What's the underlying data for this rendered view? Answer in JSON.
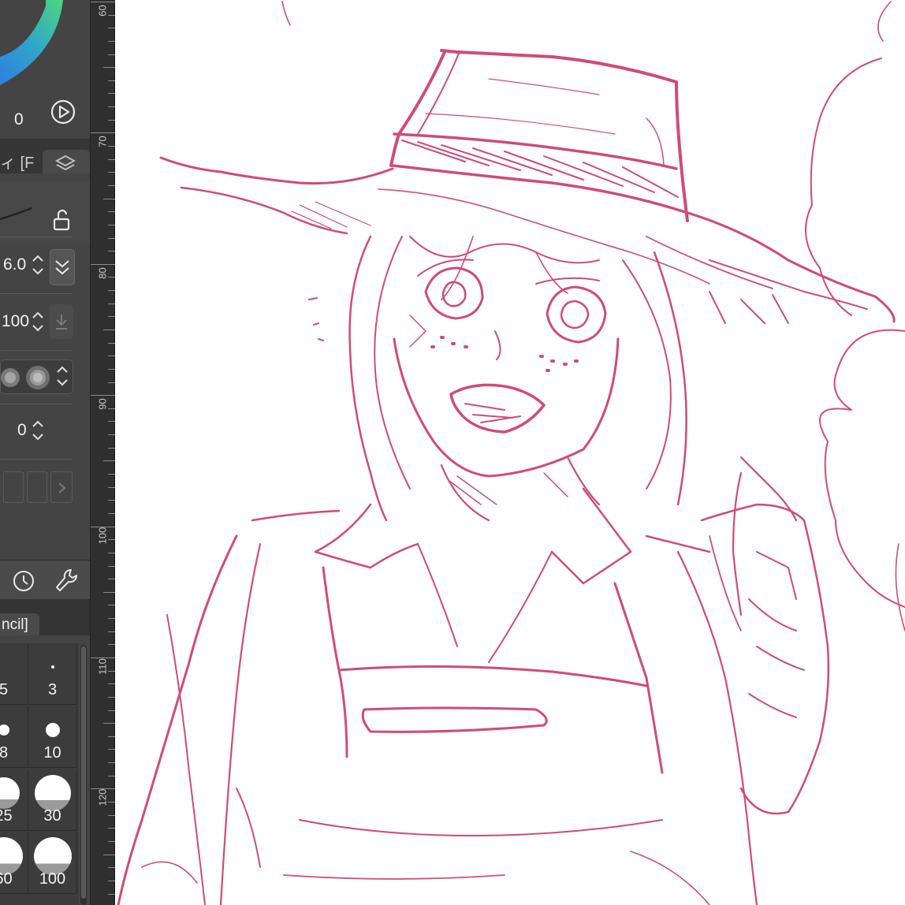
{
  "panel": {
    "color_value": "0",
    "tab_label": "ィ [F",
    "brush_size_value": "6.0",
    "opacity_value": "100",
    "stabilizer_value": "0",
    "subtool_tab_label": "ncil]",
    "brush_sizes": [
      {
        "label": "5",
        "dot": 0
      },
      {
        "label": "3",
        "dot": 4
      },
      {
        "label": "8",
        "dot": 14
      },
      {
        "label": "10",
        "dot": 18
      },
      {
        "label": "25",
        "dot": 40
      },
      {
        "label": "30",
        "dot": 46
      },
      {
        "label": "60",
        "dot": 48
      },
      {
        "label": "100",
        "dot": 48
      }
    ]
  },
  "ruler": {
    "labels": [
      "60",
      "70",
      "80",
      "90",
      "100",
      "110",
      "120"
    ]
  },
  "canvas": {
    "stroke_color": "#d14a7c"
  },
  "icons": {
    "play": "play-circle-icon",
    "layers": "layers-icon",
    "lock": "unlock-icon",
    "check": "double-check-icon",
    "download": "download-icon",
    "timer": "timer-icon",
    "wrench": "wrench-icon"
  }
}
